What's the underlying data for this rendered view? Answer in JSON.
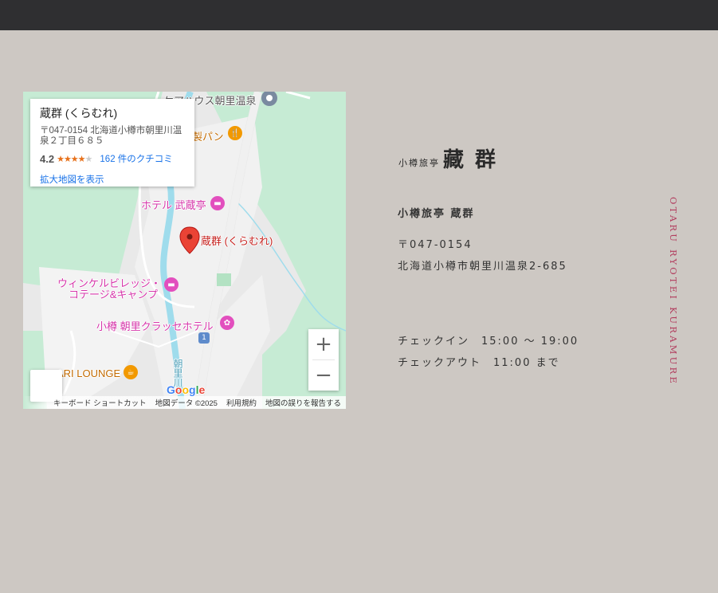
{
  "map": {
    "infocard": {
      "name": "蔵群 (くらむれ)",
      "address": "〒047-0154 北海道小樽市朝里川温泉２丁目６８５",
      "rating": "4.2",
      "stars": 4,
      "reviews": "162 件のクチコミ",
      "larger_map": "拡大地図を表示"
    },
    "labels": {
      "care_house": "ケアハウス朝里温泉",
      "bakery": "製パン",
      "hotel_musashitei": "ホテル 武蔵亭",
      "kuramure": "蔵群 (くらむれ)",
      "winkel_1": "ウィンケルビレッジ・",
      "winkel_2": "コテージ&キャンプ",
      "classe_hotel": "小樽 朝里クラッセホテル",
      "lounge": "ARI LOUNGE",
      "river": "朝里川",
      "route": "1"
    },
    "zoom_in": "+",
    "zoom_out": "−",
    "google_logo": "Google",
    "attribution": {
      "keyboard": "キーボード ショートカット",
      "data": "地図データ ©2025",
      "terms": "利用規約",
      "report": "地図の誤りを報告する"
    }
  },
  "logo": {
    "small": "小樽旅亭",
    "big": "藏群"
  },
  "details": {
    "name": "小樽旅亭 蔵群",
    "postal": "〒047-0154",
    "address": "北海道小樽市朝里川温泉2-685",
    "checkin": "チェックイン　15:00 ～ 19:00",
    "checkout": "チェックアウト　11:00 まで"
  },
  "vertical_text": "OTARU RYOTEI KURAMURE",
  "colors": {
    "accent": "#b23d5e",
    "background": "#cdc8c3",
    "topbar": "#2f2f31"
  }
}
